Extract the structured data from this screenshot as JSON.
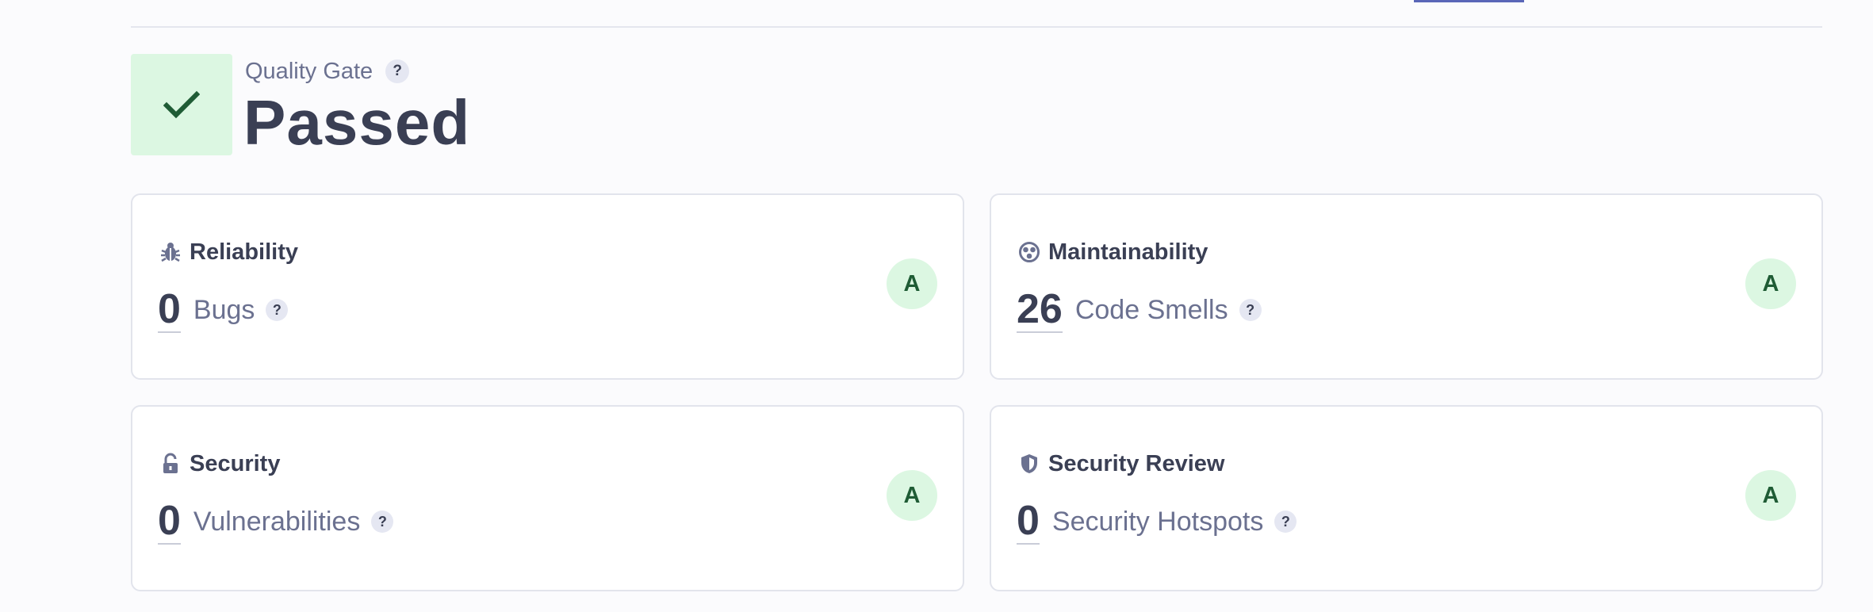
{
  "quality_gate": {
    "label": "Quality Gate",
    "help": "?",
    "status": "Passed"
  },
  "cards": [
    {
      "title": "Reliability",
      "icon": "bug-icon",
      "value": "0",
      "label": "Bugs",
      "help": "?",
      "rating": "A"
    },
    {
      "title": "Maintainability",
      "icon": "maintainability-icon",
      "value": "26",
      "label": "Code Smells",
      "help": "?",
      "rating": "A"
    },
    {
      "title": "Security",
      "icon": "unlocked-icon",
      "value": "0",
      "label": "Vulnerabilities",
      "help": "?",
      "rating": "A"
    },
    {
      "title": "Security Review",
      "icon": "shield-icon",
      "value": "0",
      "label": "Security Hotspots",
      "help": "?",
      "rating": "A"
    }
  ],
  "colors": {
    "gate_passed_bg": "#dcf7e2",
    "gate_check": "#1f5c35",
    "rating_a_bg": "#dcf7e2",
    "accent_tab": "#5a66b8"
  }
}
